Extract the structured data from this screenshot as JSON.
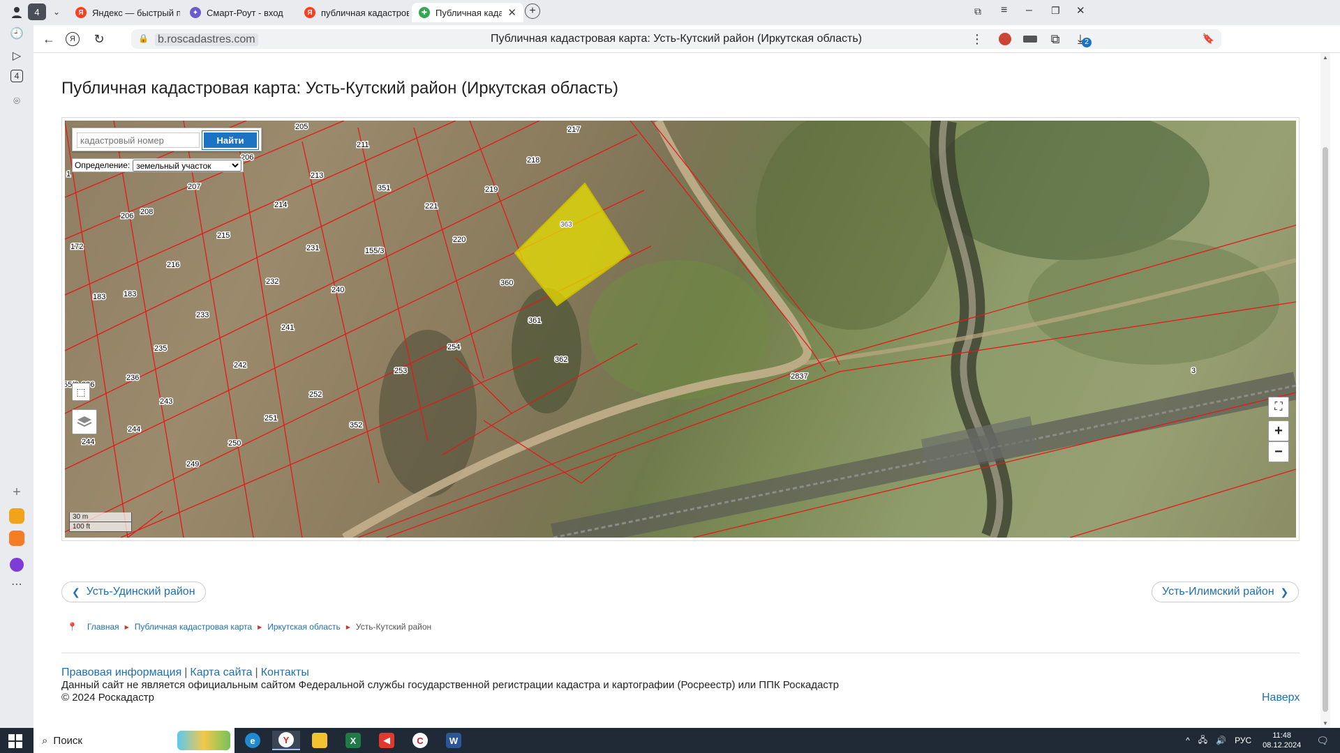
{
  "browser": {
    "tab_count_badge": "4",
    "tabs": [
      {
        "label": "Яндекс — быстрый поиск",
        "color": "#fc3f1d"
      },
      {
        "label": "Смарт-Роут - вход",
        "color": "#6a5acd"
      },
      {
        "label": "публичная кадастровая к",
        "color": "#fc3f1d"
      },
      {
        "label": "Публичная кадастрова",
        "color": "#2fa84f"
      }
    ],
    "url_host": "b.roscadastres.com",
    "page_title": "Публичная кадастровая карта: Усть-Кутский район (Иркутская область)",
    "sidebar_badge": "4",
    "downloads_badge": "2"
  },
  "breadcrumbs": {
    "items": [
      "Главная",
      "Публичная кадастровая карта",
      "Иркутская область"
    ],
    "current": "Усть-Кутский район"
  },
  "page": {
    "title": "Публичная кадастровая карта: Усть-Кутский район (Иркутская область)"
  },
  "map": {
    "search_placeholder": "кадастровый номер",
    "find_button": "Найти",
    "definition_label": "Определение:",
    "definition_value": "земельный участок",
    "scale_metric": "30 m",
    "scale_imperial": "100 ft",
    "zoom_in": "+",
    "zoom_out": "−",
    "highlight_color": "#e8e000",
    "parcel_numbers": [
      "217",
      "205",
      "211",
      "218",
      "206",
      "1",
      "213",
      "351",
      "219",
      "207",
      "214",
      "221",
      "363",
      "208",
      "206",
      "215",
      "172",
      "231",
      "155/3",
      "220",
      "216",
      "232",
      "360",
      "183",
      "183",
      "240",
      "233",
      "361",
      "241",
      "254",
      "235",
      "362",
      "242",
      "253",
      "2837",
      "3",
      "55/3",
      "236",
      "236",
      "252",
      "243",
      "251",
      "244",
      "352",
      "250",
      "244",
      "249"
    ]
  },
  "nav": {
    "prev_region": "Усть-Удинский район",
    "next_region": "Усть-Илимский район"
  },
  "footer": {
    "links": [
      "Правовая информация",
      "Карта сайта",
      "Контакты"
    ],
    "disclaimer": "Данный сайт не является официальным сайтом Федеральной службы государственной регистрации кадастра и картографии (Росреестр) или ППК Роскадастр",
    "copyright": "© 2024 Роскадастр",
    "to_top": "Наверх"
  },
  "taskbar": {
    "search_label": "Поиск",
    "language": "РУС",
    "time": "11:48",
    "date": "08.12.2024"
  }
}
